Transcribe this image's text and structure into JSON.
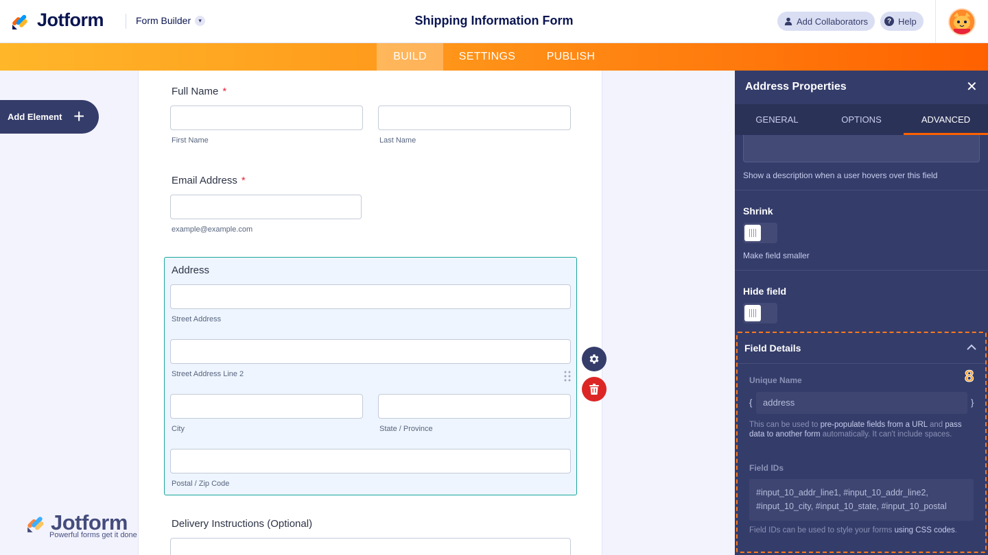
{
  "header": {
    "logo_text": "Jotform",
    "builder_label": "Form Builder",
    "form_title": "Shipping Information Form",
    "collaborators_label": "Add Collaborators",
    "help_label": "Help"
  },
  "nav": {
    "tabs": [
      {
        "label": "BUILD",
        "active": true
      },
      {
        "label": "SETTINGS",
        "active": false
      },
      {
        "label": "PUBLISH",
        "active": false
      }
    ]
  },
  "sidebar": {
    "add_element_label": "Add Element"
  },
  "form": {
    "full_name": {
      "label": "Full Name",
      "required": "*",
      "first": "First Name",
      "last": "Last Name"
    },
    "email": {
      "label": "Email Address",
      "required": "*",
      "hint": "example@example.com"
    },
    "address": {
      "label": "Address",
      "street": "Street Address",
      "street2": "Street Address Line 2",
      "city": "City",
      "state": "State / Province",
      "postal": "Postal / Zip Code"
    },
    "delivery": {
      "label": "Delivery Instructions (Optional)"
    }
  },
  "watermark": {
    "text": "Jotform",
    "tagline": "Powerful forms get it done"
  },
  "panel": {
    "title": "Address Properties",
    "close": "✕",
    "tabs": [
      {
        "label": "GENERAL",
        "active": false
      },
      {
        "label": "OPTIONS",
        "active": false
      },
      {
        "label": "ADVANCED",
        "active": true
      }
    ],
    "hover_hint": "Show a description when a user hovers over this field",
    "shrink": {
      "label": "Shrink",
      "hint": "Make field smaller",
      "on": false
    },
    "hide": {
      "label": "Hide field",
      "on": false
    },
    "field_details": {
      "title": "Field Details",
      "badge": "8",
      "unique_name_label": "Unique Name",
      "brace_open": "{",
      "brace_close": "}",
      "unique_name_value": "address",
      "unique_name_help_1": "This can be used to ",
      "unique_name_help_bold_1": "pre-populate fields from a URL",
      "unique_name_help_2": " and ",
      "unique_name_help_bold_2": "pass data to another form",
      "unique_name_help_3": " automatically. It can't include spaces.",
      "field_ids_label": "Field IDs",
      "field_ids_line1": "#input_10_addr_line1, #input_10_addr_line2,",
      "field_ids_line2": "#input_10_city, #input_10_state, #input_10_postal",
      "field_ids_help_1": "Field IDs can be used to style your forms ",
      "field_ids_help_bold": "using CSS codes",
      "field_ids_help_2": "."
    }
  },
  "colors": {
    "brand_dark": "#0a1551",
    "panel_bg": "#343c6a",
    "accent_orange": "#ff6100",
    "selected_border": "#18a59a",
    "delete_red": "#dc2626"
  }
}
